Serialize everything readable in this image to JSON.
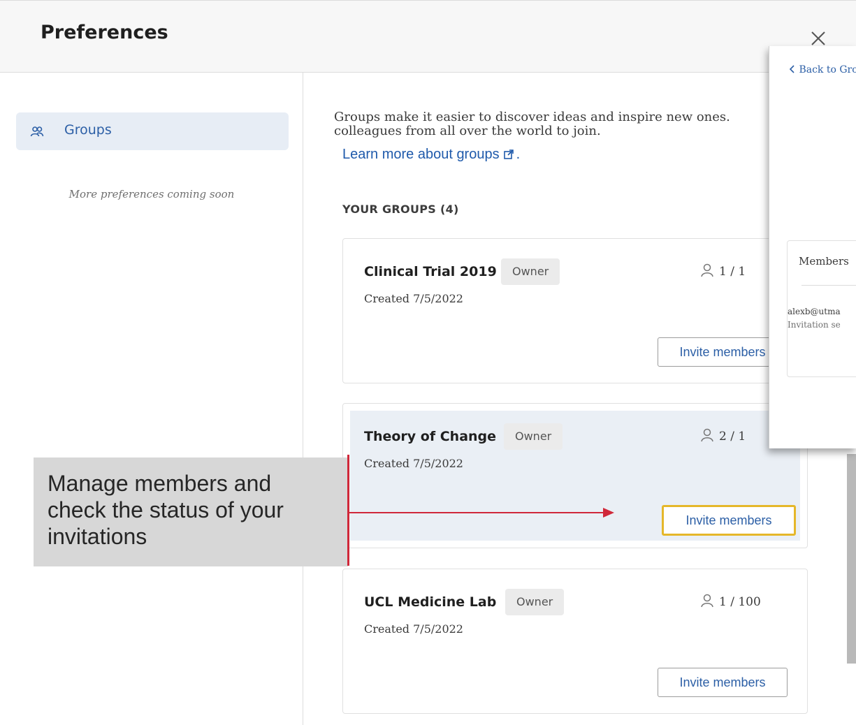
{
  "header": {
    "title": "Preferences"
  },
  "sidebar": {
    "items": [
      {
        "label": "Groups",
        "icon": "people-icon"
      }
    ],
    "note": "More preferences coming soon"
  },
  "main": {
    "intro_line1": "Groups make it easier to discover ideas and inspire new ones.",
    "intro_line2": "colleagues from all over the world to join.",
    "learn_more": "Learn more about groups",
    "learn_more_suffix": ".",
    "section_title": "YOUR GROUPS (4)",
    "groups": [
      {
        "name": "Clinical Trial 2019",
        "role": "Owner",
        "created": "Created 7/5/2022",
        "members": "1 / 1",
        "invite_label": "Invite members"
      },
      {
        "name": "Theory of Change",
        "role": "Owner",
        "created": "Created 7/5/2022",
        "members": "2 / 1",
        "invite_label": "Invite members"
      },
      {
        "name": "UCL Medicine Lab",
        "role": "Owner",
        "created": "Created 7/5/2022",
        "members": "1 / 100",
        "invite_label": "Invite members"
      }
    ]
  },
  "overlay": {
    "back_label": "Back to Gro",
    "tab_label": "Members",
    "email": "alexb@utma",
    "status": "Invitation se"
  },
  "callout": {
    "text": "Manage members and check the status of your invitations"
  },
  "colors": {
    "accent": "#2c5fa6",
    "highlight_border": "#e5b72a",
    "callout_red": "#d0283a"
  }
}
